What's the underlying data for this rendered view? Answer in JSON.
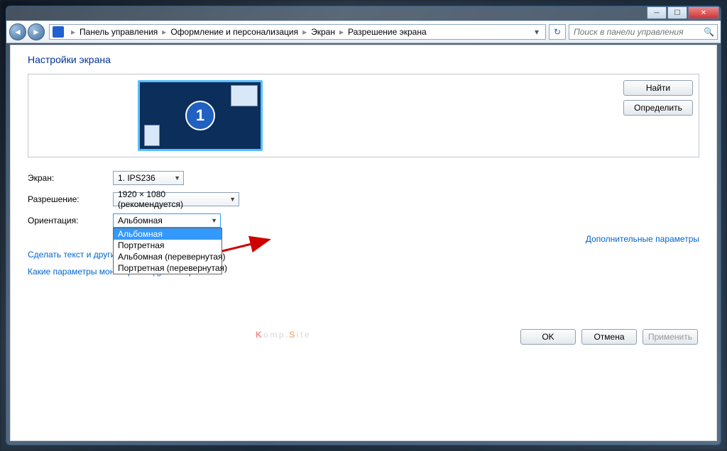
{
  "breadcrumbs": [
    "Панель управления",
    "Оформление и персонализация",
    "Экран",
    "Разрешение экрана"
  ],
  "search_placeholder": "Поиск в панели управления",
  "page_title": "Настройки экрана",
  "monitor_number": "1",
  "preview_buttons": {
    "find": "Найти",
    "detect": "Определить"
  },
  "labels": {
    "screen": "Экран:",
    "resolution": "Разрешение:",
    "orientation": "Ориентация:"
  },
  "values": {
    "screen": "1. IPS236",
    "resolution": "1920 × 1080 (рекомендуется)",
    "orientation": "Альбомная"
  },
  "orientation_options": [
    "Альбомная",
    "Портретная",
    "Альбомная (перевернутая)",
    "Портретная (перевернутая)"
  ],
  "links": {
    "advanced": "Дополнительные параметры",
    "text_size": "Сделать текст и другие",
    "help": "Какие параметры монитора следует выбрать?"
  },
  "buttons": {
    "ok": "OK",
    "cancel": "Отмена",
    "apply": "Применить"
  },
  "watermark": {
    "k": "K",
    "omp": "omp.",
    "s": "S",
    "ite": "ite"
  }
}
